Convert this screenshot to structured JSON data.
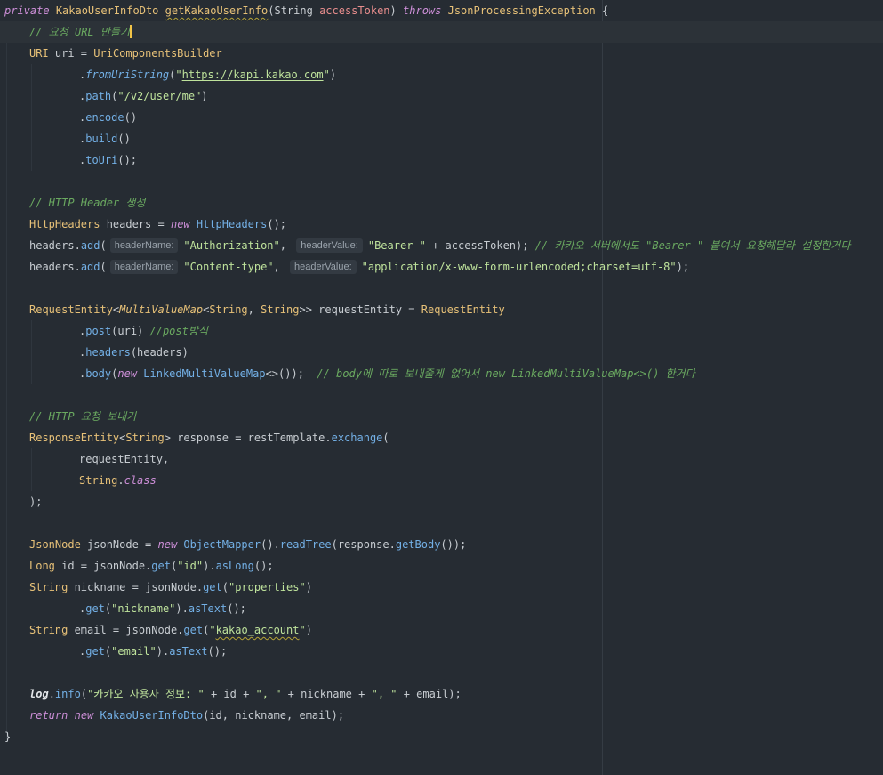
{
  "code": {
    "l1": {
      "kw_private": "private",
      "ret_type": "KakaoUserInfoDto",
      "method_name": "getKakaoUserInfo",
      "lp": "(",
      "param_type": "String",
      "param_name": "accessToken",
      "rp": ")",
      "kw_throws": "throws",
      "exc": "JsonProcessingException",
      "brace": "{"
    },
    "l2": {
      "comment": "// 요청 URL 만들기"
    },
    "l3": {
      "type": "URI",
      "rest": " uri = ",
      "builder": "UriComponentsBuilder"
    },
    "l4": {
      "dot": ".",
      "method": "fromUriString",
      "lp": "(",
      "q1": "\"",
      "url": "https://kapi.kakao.com",
      "q2": "\"",
      "rp": ")"
    },
    "l5": {
      "dot": ".",
      "method": "path",
      "lp": "(",
      "str": "\"/v2/user/me\"",
      "rp": ")"
    },
    "l6": {
      "dot": ".",
      "method": "encode",
      "args": "()"
    },
    "l7": {
      "dot": ".",
      "method": "build",
      "args": "()"
    },
    "l8": {
      "dot": ".",
      "method": "toUri",
      "args": "();"
    },
    "l10": {
      "comment": "// HTTP Header 생성"
    },
    "l11": {
      "type": "HttpHeaders",
      "var": " headers = ",
      "kw_new": "new",
      "ctor": " HttpHeaders",
      "end": "();"
    },
    "l12": {
      "obj": "headers",
      "dot": ".",
      "method": "add",
      "lp": "(",
      "hint1": "headerName:",
      "str1": "\"Authorization\"",
      "comma": ", ",
      "hint2": "headerValue:",
      "str2": "\"Bearer \"",
      "plus": " + accessToken); ",
      "comment": "// 카카오 서버에서도 \"Bearer \" 붙여서 요청해달라 설정한거다"
    },
    "l13": {
      "obj": "headers",
      "dot": ".",
      "method": "add",
      "lp": "(",
      "hint1": "headerName:",
      "str1": "\"Content-type\"",
      "comma": ", ",
      "hint2": "headerValue:",
      "str2": "\"application/x-www-form-urlencoded;charset=utf-8\"",
      "end": ");"
    },
    "l15": {
      "type": "RequestEntity",
      "lt": "<",
      "type2": "MultiValueMap",
      "lt2": "<",
      "type3": "String",
      "comma": ", ",
      "type4": "String",
      "gt": ">>",
      "var": " requestEntity = ",
      "type5": "RequestEntity"
    },
    "l16": {
      "dot": ".",
      "method": "post",
      "args": "(uri) ",
      "comment": "//post방식"
    },
    "l17": {
      "dot": ".",
      "method": "headers",
      "args": "(headers)"
    },
    "l18": {
      "dot": ".",
      "method": "body",
      "lp": "(",
      "kw_new": "new",
      "ctor": " LinkedMultiValueMap",
      "diamond": "<>",
      "end": "());  ",
      "comment": "// body에 따로 보내줄게 없어서 new LinkedMultiValueMap<>() 한거다"
    },
    "l20": {
      "comment": "// HTTP 요청 보내기"
    },
    "l21": {
      "type": "ResponseEntity",
      "lt": "<",
      "type2": "String",
      "gt": ">",
      "var": " response = restTemplate.",
      "method": "exchange",
      "lp": "("
    },
    "l22": {
      "text": "requestEntity,"
    },
    "l23": {
      "type": "String",
      "dot": ".",
      "kw_class": "class"
    },
    "l24": {
      "text": ");"
    },
    "l26": {
      "type": "JsonNode",
      "var": " jsonNode = ",
      "kw_new": "new",
      "ctor": " ObjectMapper",
      "paren": "()",
      "dot": ".",
      "method": "readTree",
      "args": "(response.",
      "method2": "getBody",
      "end": "());"
    },
    "l27": {
      "type": "Long",
      "var": " id = jsonNode.",
      "method": "get",
      "lp": "(",
      "str": "\"id\"",
      "rp": ").",
      "method2": "asLong",
      "end": "();"
    },
    "l28": {
      "type": "String",
      "var": " nickname = jsonNode.",
      "method": "get",
      "lp": "(",
      "str": "\"properties\"",
      "rp": ")"
    },
    "l29": {
      "dot": ".",
      "method": "get",
      "lp": "(",
      "str": "\"nickname\"",
      "rp": ").",
      "method2": "asText",
      "end": "();"
    },
    "l30": {
      "type": "String",
      "var": " email = jsonNode.",
      "method": "get",
      "lp": "(",
      "q1": "\"",
      "str": "kakao_account",
      "q2": "\"",
      "rp": ")"
    },
    "l31": {
      "dot": ".",
      "method": "get",
      "lp": "(",
      "str": "\"email\"",
      "rp": ").",
      "method2": "asText",
      "end": "();"
    },
    "l33": {
      "log": "log",
      "dot": ".",
      "method": "info",
      "lp": "(",
      "str1": "\"카카오 사용자 정보: \"",
      "p1": " + id + ",
      "str2": "\", \"",
      "p2": " + nickname + ",
      "str3": "\", \"",
      "p3": " + email);"
    },
    "l34": {
      "kw_return": "return",
      "sp": " ",
      "kw_new": "new",
      "ctor": " KakaoUserInfoDto",
      "args": "(id, nickname, email);"
    },
    "l35": {
      "brace": "}"
    }
  }
}
